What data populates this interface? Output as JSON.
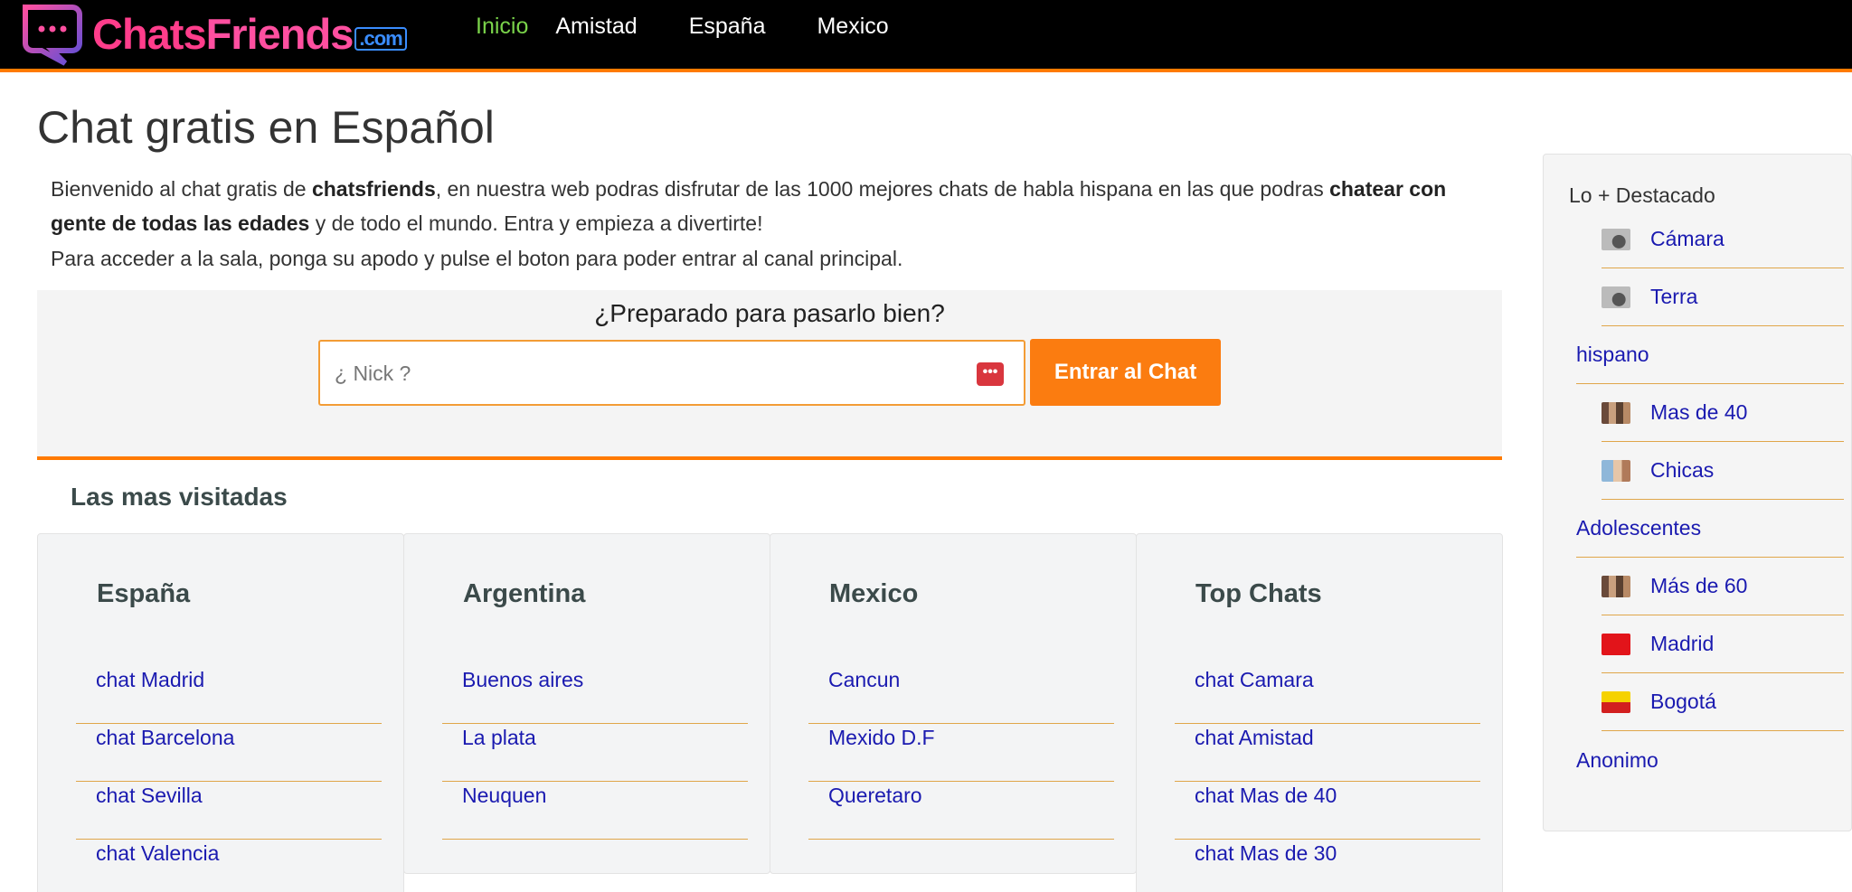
{
  "header": {
    "logo_text_1": "Chats",
    "logo_text_2": "Friends",
    "logo_domain": ".com",
    "nav": [
      {
        "label": "Inicio",
        "active": true
      },
      {
        "label": "Amistad",
        "active": false
      },
      {
        "label": "España",
        "active": false
      },
      {
        "label": "Mexico",
        "active": false
      }
    ]
  },
  "main": {
    "title": "Chat gratis en Español",
    "intro_part1": "Bienvenido al chat gratis de ",
    "intro_bold1": "chatsfriends",
    "intro_part2": ", en nuestra web podras disfrutar de las 1000 mejores chats de habla hispana en las que podras ",
    "intro_bold2": "chatear con gente de todas las edades",
    "intro_part3": " y de todo el mundo. Entra y empieza a divertirte!",
    "intro2": "Para acceder a la sala, ponga su apodo y pulse el boton para poder entrar al canal principal.",
    "chatbox": {
      "title": "¿Preparado para pasarlo bien?",
      "nick_placeholder": "¿ Nick ?",
      "enter_label": "Entrar al Chat",
      "pw_icon": "•••"
    },
    "visited_title": "Las mas visitadas",
    "cards": [
      {
        "title": "España",
        "links": [
          "chat Madrid",
          "chat Barcelona",
          "chat Sevilla",
          "chat Valencia"
        ]
      },
      {
        "title": "Argentina",
        "links": [
          "Buenos aires",
          "La plata",
          "Neuquen"
        ]
      },
      {
        "title": "Mexico",
        "links": [
          "Cancun",
          "Mexido D.F",
          "Queretaro"
        ]
      },
      {
        "title": "Top Chats",
        "links": [
          "chat Camara",
          "chat Amistad",
          "chat Mas de 40",
          "chat Mas de 30"
        ]
      }
    ]
  },
  "sidebar": {
    "title": "Lo + Destacado",
    "items": [
      {
        "label": "Cámara",
        "icon": "webcam-icon"
      },
      {
        "label": "Terra",
        "icon": "webcam-icon"
      },
      {
        "label": "hispano",
        "icon": ""
      },
      {
        "label": "Mas de 40",
        "icon": "people-icon"
      },
      {
        "label": "Chicas",
        "icon": "girls-icon"
      },
      {
        "label": "Adolescentes",
        "icon": ""
      },
      {
        "label": "Más de 60",
        "icon": "people-icon"
      },
      {
        "label": "Madrid",
        "icon": "madrid-flag-icon"
      },
      {
        "label": "Bogotá",
        "icon": "bogota-flag-icon"
      },
      {
        "label": "Anonimo",
        "icon": ""
      }
    ]
  },
  "colors": {
    "accent": "#fb7c10",
    "link": "#1a1ab0",
    "nav_active": "#7ad34a",
    "topbar": "#000000"
  }
}
